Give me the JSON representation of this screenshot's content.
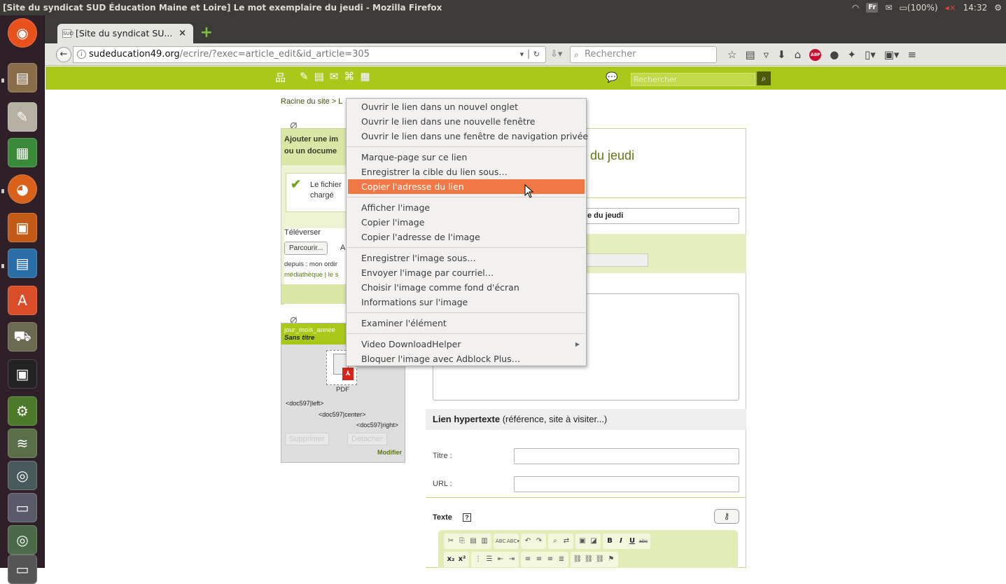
{
  "window": {
    "title": "[Site du syndicat SUD Éducation Maine et Loire] Le mot exemplaire du jeudi - Mozilla Firefox",
    "indicators": {
      "lang": "Fr",
      "battery": "(100%)",
      "time": "14:32"
    }
  },
  "browser": {
    "tab_title": "[Site du syndicat SU...",
    "url_host": "sudeducation49.org",
    "url_path": "/ecrire/?exec=article_edit&id_article=305",
    "search_placeholder": "Rechercher"
  },
  "spip": {
    "search_placeholder": "Rechercher",
    "breadcrumb": "Racine du site > L"
  },
  "upload_box": {
    "heading_line1": "Ajouter une im",
    "heading_line2": "ou un docume",
    "message_line1": "Le fichier",
    "message_line2": "chargé",
    "upload_label": "Téléverser",
    "browse_button": "Parcourir...",
    "browse_suffix": "A",
    "from_text": "depuis : mon ordir",
    "media_text": "médiathèque | le s"
  },
  "doc_box": {
    "filename": "jour_mois_annee",
    "subtitle": "Sans titre",
    "type_label": "PDF",
    "tag_left": "<doc597|left>",
    "tag_center": "<doc597|center>",
    "tag_right": "<doc597|right>",
    "delete_button": "Supprimer",
    "detach_button": "Détacher",
    "modify_link": "Modifier"
  },
  "form": {
    "article_title_visible": "e du jeudi",
    "title_field_visible": "e du jeudi",
    "link_heading_bold": "Lien hypertexte",
    "link_heading_rest": " (référence, site à visiter...)",
    "titre_label": "Titre :",
    "url_label": "URL :",
    "texte_label": "Texte",
    "help_mark": "?"
  },
  "context_menu": {
    "items": [
      "Ouvrir le lien dans un nouvel onglet",
      "Ouvrir le lien dans une nouvelle fenêtre",
      "Ouvrir le lien dans une fenêtre de navigation privée",
      "Marque-page sur ce lien",
      "Enregistrer la cible du lien sous…",
      "Copier l'adresse du lien",
      "Afficher l'image",
      "Copier l'image",
      "Copier l'adresse de l'image",
      "Enregistrer l'image sous…",
      "Envoyer l'image par courriel…",
      "Choisir l'image comme fond d'écran",
      "Informations sur l'image",
      "Examiner l'élément",
      "Video DownloadHelper",
      "Bloquer l'image avec Adblock Plus…"
    ],
    "highlighted_index": 5
  },
  "colors": {
    "spip_green": "#a8c81a",
    "menu_highlight": "#f07746",
    "ubuntu_panel": "#3c3b37"
  }
}
